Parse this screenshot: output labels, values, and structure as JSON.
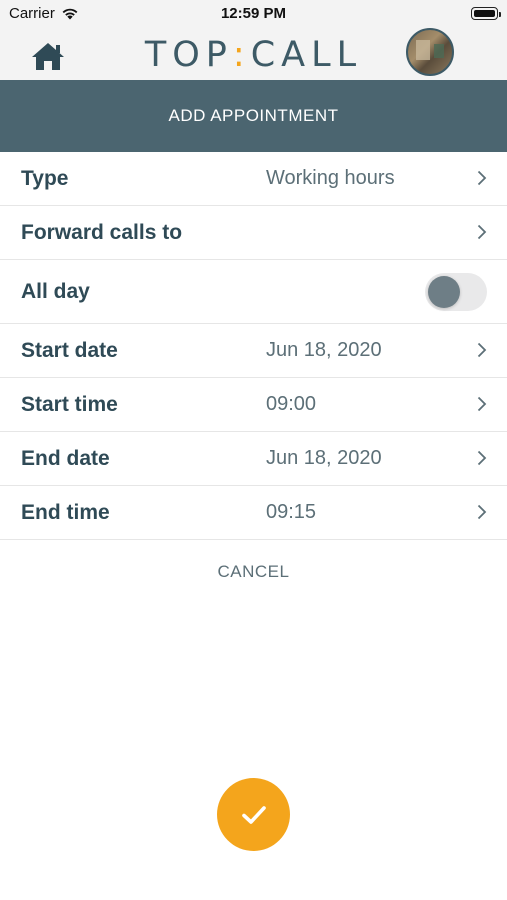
{
  "status_bar": {
    "carrier": "Carrier",
    "time": "12:59 PM",
    "icons": [
      "wifi-icon",
      "battery-icon"
    ]
  },
  "header": {
    "logo_left": "TOP",
    "logo_colon": ":",
    "logo_right": "CALL",
    "home_icon": "home-icon",
    "avatar_icon": "user-avatar",
    "logo_colors": {
      "text": "#3d5a66",
      "accent": "#f4a51c"
    }
  },
  "page": {
    "title": "ADD APPOINTMENT",
    "title_bar_color": "#4b6570"
  },
  "form": {
    "type": {
      "label": "Type",
      "value": "Working hours"
    },
    "forward": {
      "label": "Forward calls to",
      "value": ""
    },
    "all_day": {
      "label": "All day",
      "enabled": false
    },
    "start_date": {
      "label": "Start date",
      "value": "Jun 18, 2020"
    },
    "start_time": {
      "label": "Start time",
      "value": "09:00"
    },
    "end_date": {
      "label": "End date",
      "value": "Jun 18, 2020"
    },
    "end_time": {
      "label": "End time",
      "value": "09:15"
    },
    "row_icon": "chevron-right-icon"
  },
  "actions": {
    "cancel_label": "CANCEL",
    "confirm_icon": "checkmark-icon",
    "confirm_color": "#f4a51c"
  }
}
